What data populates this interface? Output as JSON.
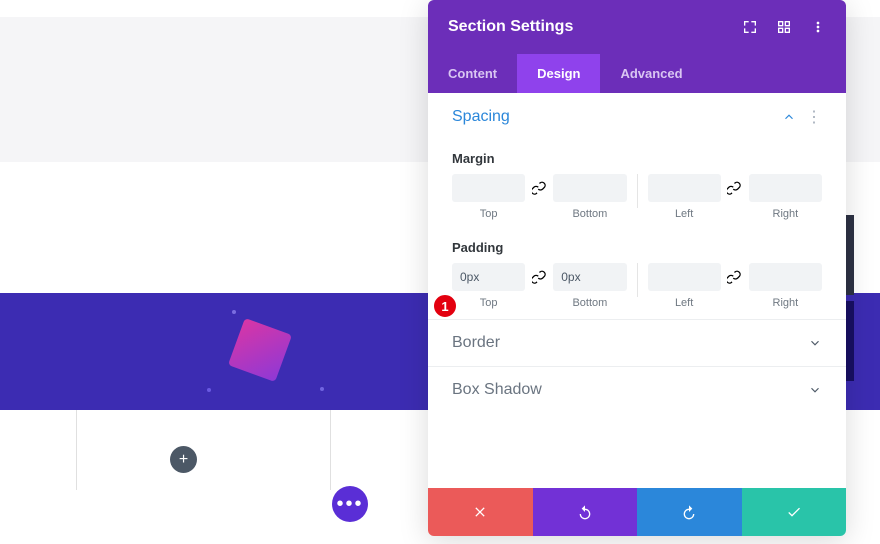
{
  "panel": {
    "title": "Section Settings",
    "tabs": {
      "content": "Content",
      "design": "Design",
      "advanced": "Advanced",
      "active": "design"
    }
  },
  "spacing": {
    "title": "Spacing",
    "margin": {
      "label": "Margin",
      "top": {
        "value": "",
        "label": "Top"
      },
      "bottom": {
        "value": "",
        "label": "Bottom"
      },
      "left": {
        "value": "",
        "label": "Left"
      },
      "right": {
        "value": "",
        "label": "Right"
      }
    },
    "padding": {
      "label": "Padding",
      "top": {
        "value": "0px",
        "label": "Top"
      },
      "bottom": {
        "value": "0px",
        "label": "Bottom"
      },
      "left": {
        "value": "",
        "label": "Left"
      },
      "right": {
        "value": "",
        "label": "Right"
      }
    }
  },
  "groups": {
    "border": "Border",
    "box_shadow": "Box Shadow"
  },
  "annotation": {
    "num": "1"
  },
  "glyphs": {
    "plus": "+",
    "dots": "•••"
  }
}
